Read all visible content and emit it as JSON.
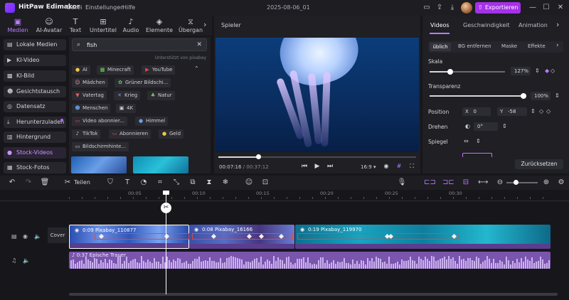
{
  "app": {
    "title": "HitPaw Edimakor",
    "menu": [
      "Datei",
      "Einstellungen",
      "Hilfe"
    ],
    "project_name": "2025-08-06_01",
    "export_label": "Exportieren",
    "accent": "#a531e8"
  },
  "media_tabs": [
    {
      "label": "Medien",
      "icon": "folder-icon"
    },
    {
      "label": "AI-Avatar",
      "icon": "ai-avatar-icon"
    },
    {
      "label": "Text",
      "icon": "text-icon"
    },
    {
      "label": "Untertitel",
      "icon": "subtitle-icon"
    },
    {
      "label": "Audio",
      "icon": "music-icon"
    },
    {
      "label": "Elemente",
      "icon": "elements-icon"
    },
    {
      "label": "Übergan",
      "icon": "transition-icon"
    }
  ],
  "categories": [
    {
      "label": "Lokale Medien",
      "icon": "folder-icon"
    },
    {
      "label": "KI-Video",
      "icon": "ai-video-icon"
    },
    {
      "label": "KI-Bild",
      "icon": "ai-image-icon"
    },
    {
      "label": "Gesichtstausch",
      "icon": "face-swap-icon"
    },
    {
      "label": "Datensatz",
      "icon": "dataset-icon"
    },
    {
      "label": "Herunterzuladen",
      "icon": "download-icon"
    },
    {
      "label": "Hintergrund",
      "icon": "background-icon"
    },
    {
      "label": "Stock-Videos",
      "icon": "stock-video-icon"
    },
    {
      "label": "Stock-Fotos",
      "icon": "stock-photo-icon"
    }
  ],
  "search": {
    "value": "fish",
    "supported_by": "Unterstützt von pixabay"
  },
  "suggestion_chips": [
    {
      "label": "AI",
      "icon": "lightbulb-icon"
    },
    {
      "label": "Minecraft",
      "icon": "image-icon"
    },
    {
      "label": "YouTube",
      "icon": "video-icon"
    },
    {
      "label": "Mädchen",
      "icon": "girl-icon"
    },
    {
      "label": "Grüner Bildschi...",
      "icon": "green-screen-icon"
    },
    {
      "label": "Vatertag",
      "icon": "tie-icon"
    },
    {
      "label": "Krieg",
      "icon": "war-icon"
    },
    {
      "label": "Natur",
      "icon": "nature-icon"
    },
    {
      "label": "Menschen",
      "icon": "people-icon"
    },
    {
      "label": "4K",
      "icon": "4k-icon"
    },
    {
      "label": "Video abonnier...",
      "icon": "subscribe-icon"
    },
    {
      "label": "Himmel",
      "icon": "sky-icon"
    },
    {
      "label": "TikTok",
      "icon": "tiktok-icon"
    },
    {
      "label": "Abonnieren",
      "icon": "subscribe-icon"
    },
    {
      "label": "Geld",
      "icon": "coin-icon"
    },
    {
      "label": "Bildschirmhinte...",
      "icon": "screen-background-icon"
    }
  ],
  "player": {
    "title": "Spieler",
    "current_time": "00:07:16",
    "total_time": "00:37:12",
    "aspect": "16:9",
    "progress": 0.2
  },
  "properties": {
    "tabs": [
      "Videos",
      "Geschwindigkeit",
      "Animation"
    ],
    "subtabs": [
      "üblich",
      "BG entfernen",
      "Maske",
      "Effekte"
    ],
    "scale_label": "Skala",
    "scale_value": "127%",
    "scale_level": 0.27,
    "transparency_label": "Transparenz",
    "transparency_value": "100%",
    "transparency_level": 1.0,
    "position_label": "Position",
    "pos_x_label": "X",
    "pos_x": "0",
    "pos_y_label": "Y",
    "pos_y": "-58",
    "rotate_label": "Drehen",
    "rotate_value": "0°",
    "mirror_label": "Spiegel",
    "reset_label": "Zurücksetzen"
  },
  "toolbar": {
    "split_label": "Teilen"
  },
  "timeline": {
    "ruler": [
      "00:05",
      "00:10",
      "00:15",
      "00:20",
      "00:25",
      "00:30"
    ],
    "cover_label": "Cover",
    "clips": [
      {
        "label": "0:09 Pixabay_110877"
      },
      {
        "label": "0:08 Pixabay_16166"
      },
      {
        "label": "0:19 Pixabay_119970"
      }
    ],
    "audio_label": "0:37 Epische Trauer"
  }
}
